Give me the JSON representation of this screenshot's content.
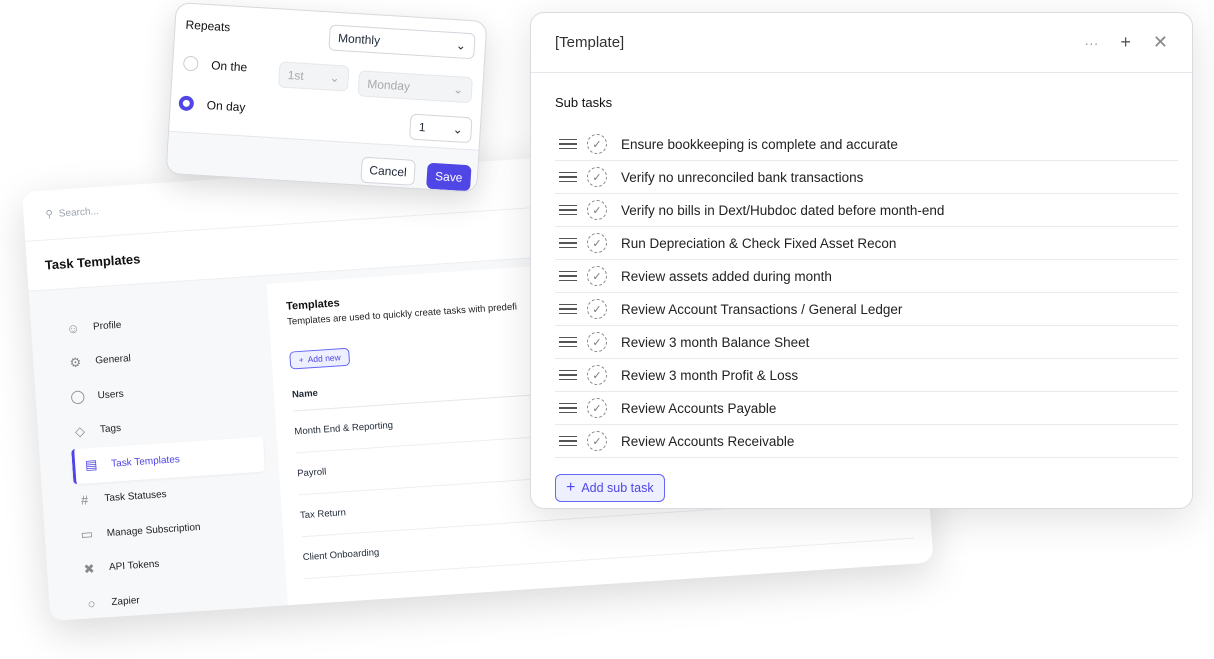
{
  "settings": {
    "search_placeholder": "Search...",
    "title": "Task Templates",
    "sidebar": [
      {
        "label": "Profile",
        "icon": "user-circle-icon"
      },
      {
        "label": "General",
        "icon": "gear-icon"
      },
      {
        "label": "Users",
        "icon": "users-icon"
      },
      {
        "label": "Tags",
        "icon": "tag-icon"
      },
      {
        "label": "Task Templates",
        "icon": "document-icon",
        "active": true
      },
      {
        "label": "Task Statuses",
        "icon": "hash-icon"
      },
      {
        "label": "Manage Subscription",
        "icon": "credit-card-icon"
      },
      {
        "label": "API Tokens",
        "icon": "tools-icon"
      },
      {
        "label": "Zapier",
        "icon": "zapier-icon"
      }
    ],
    "templates": {
      "heading": "Templates",
      "description": "Templates are used to quickly create tasks with predefi",
      "add_new": "Add new",
      "column_name": "Name",
      "rows": [
        "Month End & Reporting",
        "Payroll",
        "Tax Return",
        "Client Onboarding"
      ]
    }
  },
  "repeat_popup": {
    "repeats_label": "Repeats",
    "repeats_value": "Monthly",
    "on_the_label": "On the",
    "on_the_ordinal": "1st",
    "on_the_weekday": "Monday",
    "on_day_label": "On day",
    "on_day_value": "1",
    "selected": "On day",
    "cancel": "Cancel",
    "save": "Save"
  },
  "template_modal": {
    "title": "[Template]",
    "subtasks_heading": "Sub tasks",
    "subtasks": [
      "Ensure bookkeeping is complete and accurate",
      "Verify no unreconciled bank transactions",
      "Verify no bills in Dext/Hubdoc dated before month-end",
      "Run Depreciation & Check Fixed Asset Recon",
      "Review assets added during month",
      "Review Account Transactions / General Ledger",
      "Review 3 month Balance Sheet",
      "Review 3 month Profit & Loss",
      "Review Accounts Payable",
      "Review Accounts Receivable"
    ],
    "add_subtask": "Add sub task"
  },
  "colors": {
    "accent": "#4f46e5",
    "danger": "#dc2626"
  }
}
